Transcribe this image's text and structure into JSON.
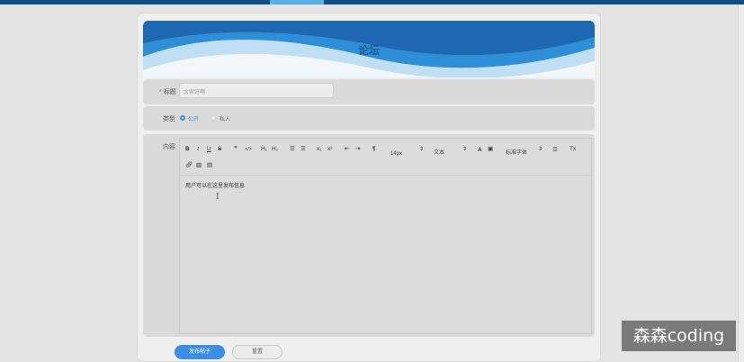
{
  "banner": {
    "title": "论坛"
  },
  "form": {
    "title_label": "标题",
    "title_required_mark": "*",
    "title_placeholder": "大家好啊",
    "type_label": "类型",
    "type_options": [
      "公开",
      "私人"
    ],
    "type_selected": "公开",
    "content_label": "内容"
  },
  "toolbar": {
    "bold": "B",
    "italic": "I",
    "underline": "U",
    "strike": "S",
    "quote": "❞",
    "code": "</>",
    "h1": "H₁",
    "h2": "H₂",
    "ordered_list": "☰",
    "bullet_list": "☰",
    "subscript": "x₁",
    "superscript": "x²",
    "outdent": "⇤",
    "indent": "⇥",
    "text_direction": "¶",
    "font_size": "14px",
    "heading_select": "文本",
    "font_family": "标准字体",
    "clear_format": "Tx"
  },
  "editor": {
    "content": "用户可以在这里发布信息"
  },
  "buttons": {
    "publish": "发布帖子",
    "reset": "重置"
  },
  "watermark": "森森coding"
}
